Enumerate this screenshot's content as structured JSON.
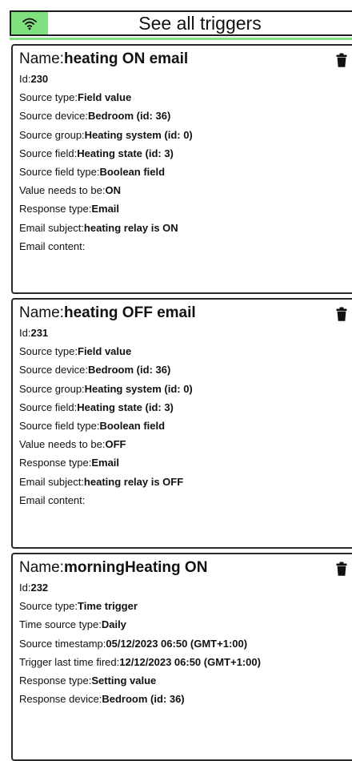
{
  "header": {
    "title": "See all triggers",
    "icon": "wifi-icon",
    "accent": "#7fe07f"
  },
  "cards": [
    {
      "name_label": "Name:",
      "name": "heating ON email",
      "rows": [
        {
          "label": "Id:",
          "value": "230"
        },
        {
          "label": "Source type:",
          "value": "Field value"
        },
        {
          "label": "Source device:",
          "value": "Bedroom (id: 36)"
        },
        {
          "label": "Source group:",
          "value": "Heating system (id: 0)"
        },
        {
          "label": "Source field:",
          "value": "Heating state (id: 3)"
        },
        {
          "label": "Source field type:",
          "value": "Boolean field"
        },
        {
          "label": "Value needs to be:",
          "value": "ON"
        },
        {
          "label": "Response type:",
          "value": "Email"
        },
        {
          "label": "Email subject:",
          "value": "heating relay is ON"
        },
        {
          "label": "Email content:",
          "value": ""
        }
      ]
    },
    {
      "name_label": "Name:",
      "name": "heating OFF email",
      "rows": [
        {
          "label": "Id:",
          "value": "231"
        },
        {
          "label": "Source type:",
          "value": "Field value"
        },
        {
          "label": "Source device:",
          "value": "Bedroom (id: 36)"
        },
        {
          "label": "Source group:",
          "value": "Heating system (id: 0)"
        },
        {
          "label": "Source field:",
          "value": "Heating state (id: 3)"
        },
        {
          "label": "Source field type:",
          "value": "Boolean field"
        },
        {
          "label": "Value needs to be:",
          "value": "OFF"
        },
        {
          "label": "Response type:",
          "value": "Email"
        },
        {
          "label": "Email subject:",
          "value": "heating relay is OFF"
        },
        {
          "label": "Email content:",
          "value": ""
        }
      ]
    },
    {
      "name_label": "Name:",
      "name": "morningHeating ON",
      "rows": [
        {
          "label": "Id:",
          "value": "232"
        },
        {
          "label": "Source type:",
          "value": "Time trigger"
        },
        {
          "label": "Time source type:",
          "value": "Daily"
        },
        {
          "label": "Source timestamp:",
          "value": "05/12/2023 06:50 (GMT+1:00)"
        },
        {
          "label": "Trigger last time fired:",
          "value": "12/12/2023 06:50 (GMT+1:00)"
        },
        {
          "label": "Response type:",
          "value": "Setting value"
        },
        {
          "label": "Response device:",
          "value": "Bedroom (id: 36)"
        }
      ]
    }
  ]
}
